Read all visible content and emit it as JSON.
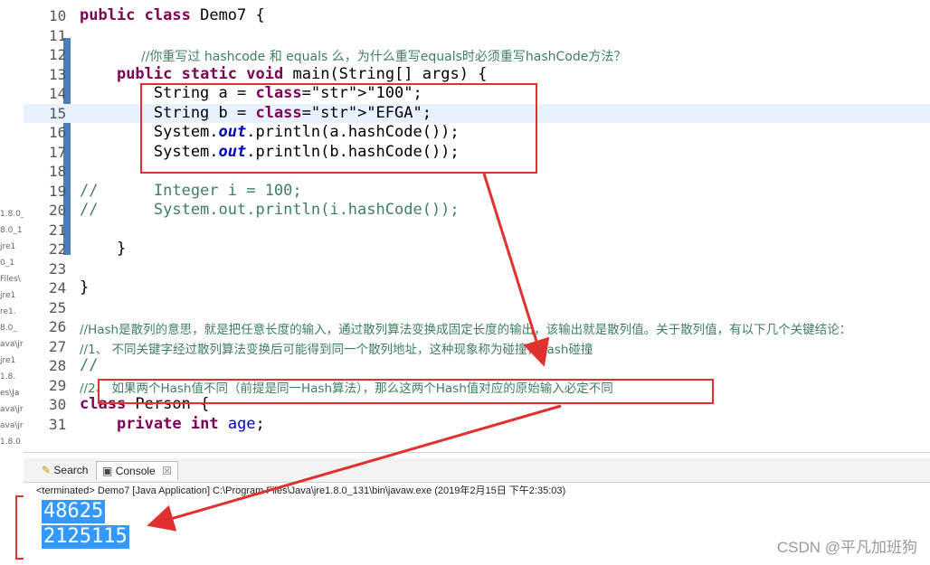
{
  "left_fragments": [
    "1.8.0_",
    "8.0_1",
    "jre1",
    "0_1",
    "Files\\",
    "jre1",
    "re1.",
    "8.0_",
    "ava\\jr",
    "jre1",
    "1.8.",
    "es\\Ja",
    "ava\\jr",
    "ava\\jr",
    "1.8.0"
  ],
  "code_lines": [
    {
      "num": "10",
      "text": "public class Demo7 {"
    },
    {
      "num": "11",
      "text": ""
    },
    {
      "num": "12",
      "text": "    //你重写过 hashcode 和 equals 么，为什么重写equals时必须重写hashCode方法？"
    },
    {
      "num": "13",
      "text": "    public static void main(String[] args) {"
    },
    {
      "num": "14",
      "text": "        String a = \"100\";"
    },
    {
      "num": "15",
      "text": "        String b = \"EFGA\";"
    },
    {
      "num": "16",
      "text": "        System.out.println(a.hashCode());"
    },
    {
      "num": "17",
      "text": "        System.out.println(b.hashCode());"
    },
    {
      "num": "18",
      "text": ""
    },
    {
      "num": "19",
      "text": "//      Integer i = 100;"
    },
    {
      "num": "20",
      "text": "//      System.out.println(i.hashCode());"
    },
    {
      "num": "21",
      "text": ""
    },
    {
      "num": "22",
      "text": "    }"
    },
    {
      "num": "23",
      "text": ""
    },
    {
      "num": "24",
      "text": "}"
    },
    {
      "num": "25",
      "text": ""
    },
    {
      "num": "26",
      "text": "//Hash是散列的意思，就是把任意长度的输入，通过散列算法变换成固定长度的输出，该输出就是散列值。关于散列值，有以下几个关键结论："
    },
    {
      "num": "27",
      "text": "//1、 不同关键字经过散列算法变换后可能得到同一个散列地址，这种现象称为碰撞，hash碰撞"
    },
    {
      "num": "28",
      "text": "//"
    },
    {
      "num": "29",
      "text": "//2、 如果两个Hash值不同（前提是同一Hash算法），那么这两个Hash值对应的原始输入必定不同"
    },
    {
      "num": "30",
      "text": "class Person {"
    },
    {
      "num": "31",
      "text": "    private int age;"
    }
  ],
  "tabs": {
    "search": "Search",
    "console": "Console"
  },
  "terminated_text": "<terminated> Demo7 [Java Application] C:\\Program Files\\Java\\jre1.8.0_131\\bin\\javaw.exe (2019年2月15日 下午2:35:03)",
  "console_output": [
    "48625",
    "2125115"
  ],
  "watermark": "CSDN @平凡加班狗",
  "colors": {
    "annotation_red": "#e03030",
    "selection": "#3399ff",
    "keyword": "#7f0055",
    "string": "#2a00ff",
    "comment": "#3f7f5f"
  }
}
